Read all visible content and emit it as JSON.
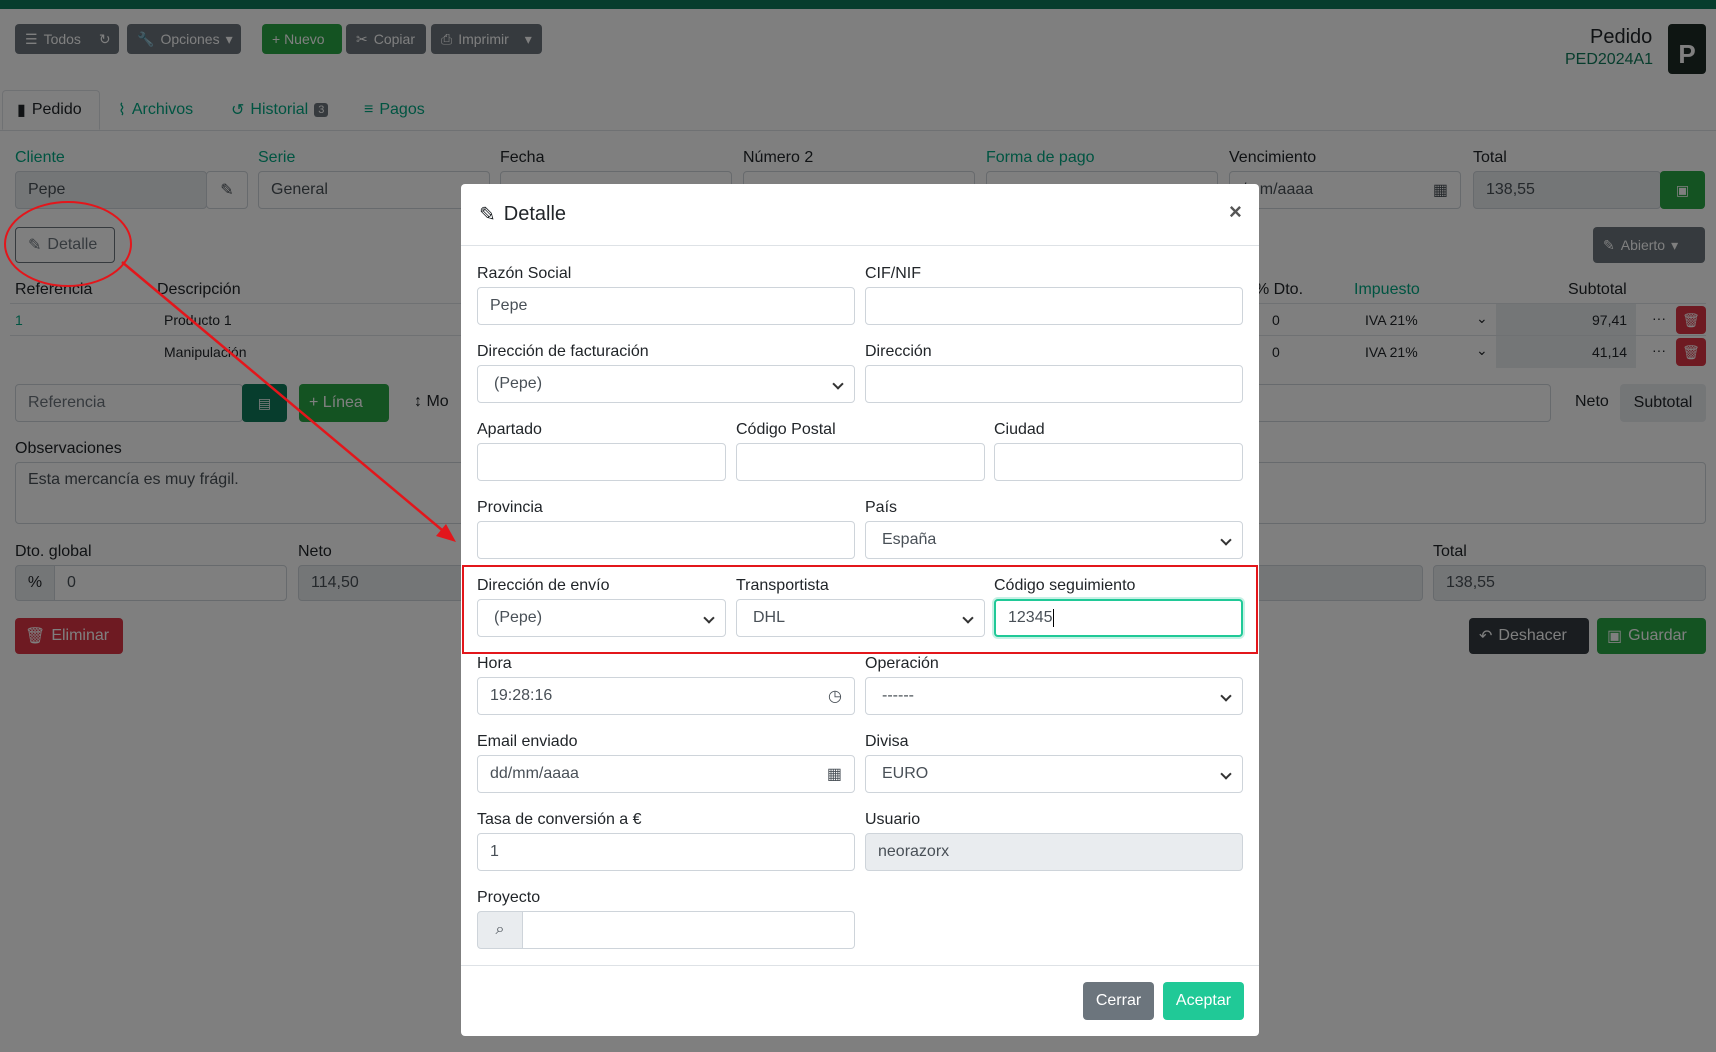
{
  "toolbar": {
    "todos": "Todos",
    "opciones": "Opciones",
    "nuevo": "+ Nuevo",
    "copiar": "Copiar",
    "imprimir": "Imprimir"
  },
  "doc": {
    "type": "Pedido",
    "code": "PED2024A1",
    "badge": "P"
  },
  "tabs": [
    {
      "label": "Pedido"
    },
    {
      "label": "Archivos"
    },
    {
      "label": "Historial",
      "count": "3"
    },
    {
      "label": "Pagos"
    }
  ],
  "header_fields": {
    "cliente_label": "Cliente",
    "cliente_value": "Pepe",
    "serie_label": "Serie",
    "serie_value": "General",
    "fecha_label": "Fecha",
    "numero2_label": "Número 2",
    "forma_pago_label": "Forma de pago",
    "vencimiento_label": "Vencimiento",
    "vencimiento_value": "/mm/aaaa",
    "total_label": "Total",
    "total_value": "138,55"
  },
  "detalle_button": "Detalle",
  "abierto_button": "Abierto",
  "lines": {
    "headers": {
      "referencia": "Referencia",
      "descripcion": "Descripción",
      "dto": "% Dto.",
      "impuesto": "Impuesto",
      "subtotal": "Subtotal"
    },
    "rows": [
      {
        "ref": "1",
        "desc": "Producto 1",
        "dto": "0",
        "iva": "IVA 21%",
        "subtotal": "97,41"
      },
      {
        "ref": "",
        "desc": "Manipulación",
        "dto": "0",
        "iva": "IVA 21%",
        "subtotal": "41,14"
      }
    ]
  },
  "add_line": {
    "referencia_placeholder": "Referencia",
    "linea_button": "+ Línea",
    "mover_partial": "Mo",
    "neto": "Neto",
    "subtotal": "Subtotal"
  },
  "observaciones": {
    "label": "Observaciones",
    "value": "Esta mercancía es muy frágil."
  },
  "totals": {
    "dto_label": "Dto. global",
    "dto_value": "0",
    "neto_label": "Neto",
    "neto_value": "114,50",
    "total_label": "Total",
    "total_value": "138,55"
  },
  "bottom_buttons": {
    "eliminar": "Eliminar",
    "deshacer": "Deshacer",
    "guardar": "Guardar"
  },
  "modal": {
    "title": "Detalle",
    "close": "×",
    "razon_social_label": "Razón Social",
    "razon_social_value": "Pepe",
    "cif_label": "CIF/NIF",
    "dir_fact_label": "Dirección de facturación",
    "dir_fact_value": "(Pepe)",
    "direccion_label": "Dirección",
    "apartado_label": "Apartado",
    "cp_label": "Código Postal",
    "ciudad_label": "Ciudad",
    "provincia_label": "Provincia",
    "pais_label": "País",
    "pais_value": "España",
    "dir_envio_label": "Dirección de envío",
    "dir_envio_value": "(Pepe)",
    "transportista_label": "Transportista",
    "transportista_value": "DHL",
    "codigo_seg_label": "Código seguimiento",
    "codigo_seg_value": "12345",
    "hora_label": "Hora",
    "hora_value": "19:28:16",
    "operacion_label": "Operación",
    "operacion_value": "------",
    "email_label": "Email enviado",
    "email_value": "dd/mm/aaaa",
    "divisa_label": "Divisa",
    "divisa_value": "EURO",
    "tasa_label": "Tasa de conversión a €",
    "tasa_value": "1",
    "usuario_label": "Usuario",
    "usuario_value": "neorazorx",
    "proyecto_label": "Proyecto",
    "cerrar": "Cerrar",
    "aceptar": "Aceptar"
  },
  "colors": {
    "accent": "#00a883",
    "annotation": "#e3161b",
    "primary_green": "#28a745"
  }
}
